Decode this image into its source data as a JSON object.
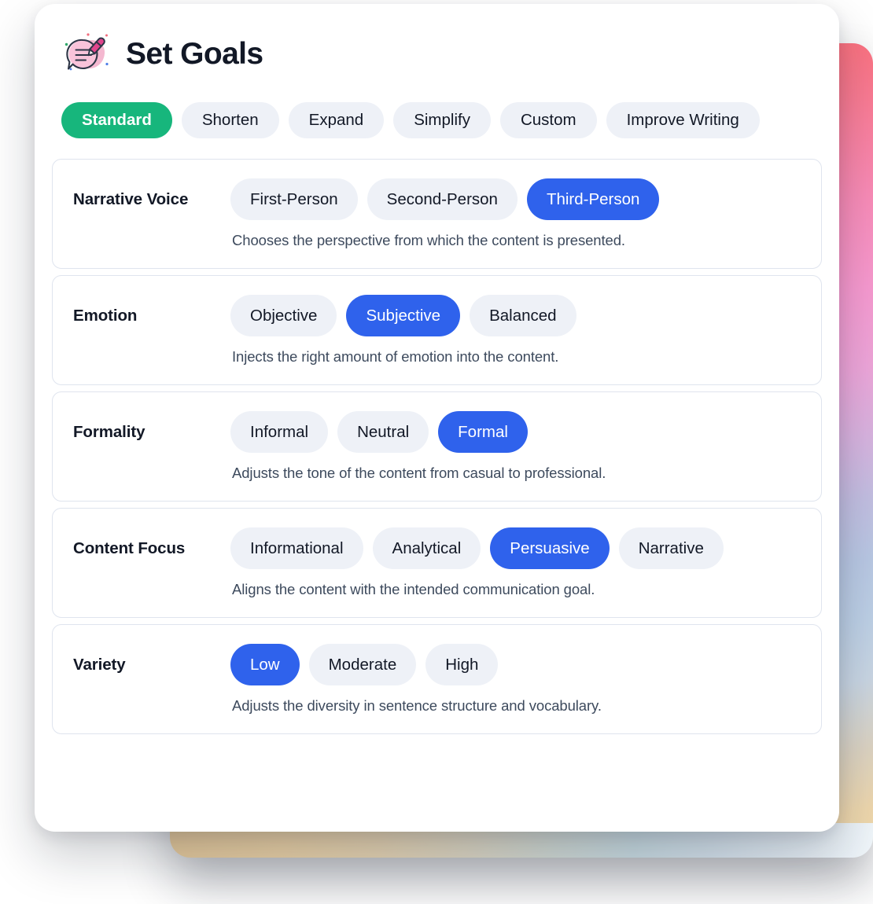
{
  "header": {
    "title": "Set Goals",
    "icon": "speech-bubble-pen-icon"
  },
  "tabs": [
    {
      "label": "Standard",
      "active": true
    },
    {
      "label": "Shorten",
      "active": false
    },
    {
      "label": "Expand",
      "active": false
    },
    {
      "label": "Simplify",
      "active": false
    },
    {
      "label": "Custom",
      "active": false
    },
    {
      "label": "Improve Writing",
      "active": false
    }
  ],
  "settings": [
    {
      "label": "Narrative Voice",
      "description": "Chooses the perspective from which the content is presented.",
      "options": [
        {
          "label": "First-Person",
          "selected": false
        },
        {
          "label": "Second-Person",
          "selected": false
        },
        {
          "label": "Third-Person",
          "selected": true
        }
      ]
    },
    {
      "label": "Emotion",
      "description": "Injects the right amount of emotion into the content.",
      "options": [
        {
          "label": "Objective",
          "selected": false
        },
        {
          "label": "Subjective",
          "selected": true
        },
        {
          "label": "Balanced",
          "selected": false
        }
      ]
    },
    {
      "label": "Formality",
      "description": "Adjusts the tone of the content from casual to professional.",
      "options": [
        {
          "label": "Informal",
          "selected": false
        },
        {
          "label": "Neutral",
          "selected": false
        },
        {
          "label": "Formal",
          "selected": true
        }
      ]
    },
    {
      "label": "Content Focus",
      "description": "Aligns the content with the intended communication goal.",
      "options": [
        {
          "label": "Informational",
          "selected": false
        },
        {
          "label": "Analytical",
          "selected": false
        },
        {
          "label": "Persuasive",
          "selected": true
        },
        {
          "label": "Narrative",
          "selected": false
        }
      ]
    },
    {
      "label": "Variety",
      "description": "Adjusts the diversity in sentence structure and vocabulary.",
      "options": [
        {
          "label": "Low",
          "selected": true
        },
        {
          "label": "Moderate",
          "selected": false
        },
        {
          "label": "High",
          "selected": false
        }
      ]
    }
  ],
  "colors": {
    "active_tab": "#17b67c",
    "selected_option": "#2f62ec",
    "pill_background": "#eef1f7",
    "text_primary": "#121826",
    "text_secondary": "#3d4a5d",
    "card_border": "#dfe4ee",
    "gradient_top": "#fb6b6f",
    "gradient_mid": "#f79ad0",
    "gradient_bottom": "#e4c89b"
  }
}
